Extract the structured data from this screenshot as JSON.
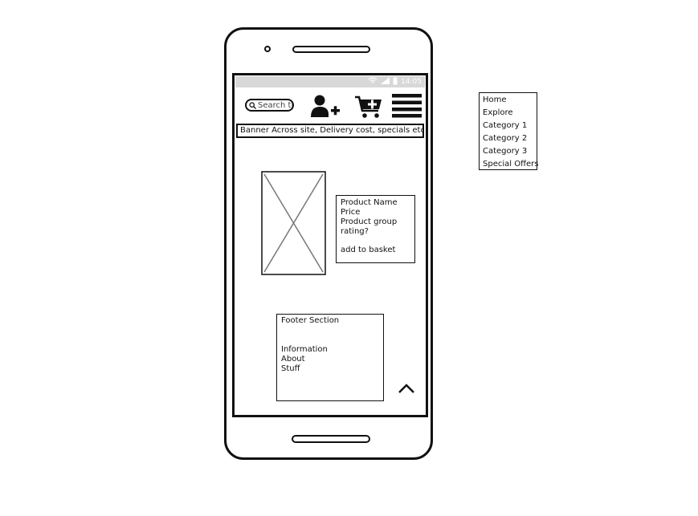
{
  "status_bar": {
    "time": "14:05",
    "icons": [
      "wifi-icon",
      "signal-icon",
      "battery-icon"
    ]
  },
  "header": {
    "search_placeholder": "Search th",
    "icons": [
      "search-icon",
      "add-user-icon",
      "add-to-cart-icon",
      "hamburger-menu-icon"
    ]
  },
  "banner": {
    "text": "Banner Across site, Delivery cost, specials etc"
  },
  "product": {
    "name": "Product Name",
    "price": "Price",
    "group": "Product group",
    "rating": "rating?",
    "add_to_basket": "add to basket"
  },
  "footer": {
    "title": "Footer Section",
    "links": [
      "Information",
      "About",
      "Stuff"
    ]
  },
  "nav_menu": {
    "items": [
      "Home",
      "Explore",
      "Category 1",
      "Category 2",
      "Category 3",
      "Special Offers"
    ]
  }
}
